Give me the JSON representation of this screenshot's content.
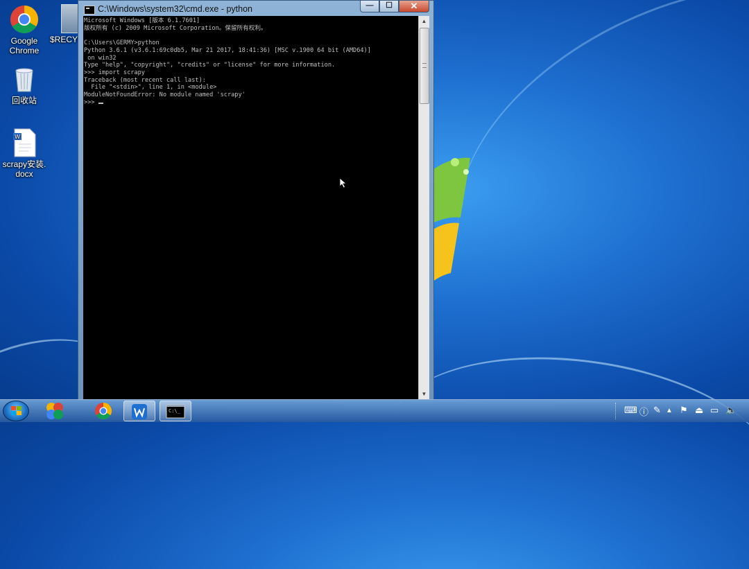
{
  "desktop": {
    "icons": [
      {
        "label": "Google\nChrome"
      },
      {
        "label": "$RECYC"
      },
      {
        "label": "回收站"
      },
      {
        "label": "scrapy安装.\ndocx"
      }
    ]
  },
  "window": {
    "title": "C:\\Windows\\system32\\cmd.exe - python",
    "min_label": "—",
    "max_label": "☐",
    "close_label": "✕"
  },
  "console": {
    "lines": [
      "Microsoft Windows [版本 6.1.7601]",
      "版权所有 (c) 2009 Microsoft Corporation。保留所有权利。",
      "",
      "C:\\Users\\GERMY>python",
      "Python 3.6.1 (v3.6.1:69c0db5, Mar 21 2017, 18:41:36) [MSC v.1900 64 bit (AMD64)]",
      " on win32",
      "Type \"help\", \"copyright\", \"credits\" or \"license\" for more information.",
      ">>> import scrapy",
      "Traceback (most recent call last):",
      "  File \"<stdin>\", line 1, in <module>",
      "ModuleNotFoundError: No module named 'scrapy'",
      ">>> "
    ]
  },
  "taskbar": {
    "items": [
      "start",
      "photo-app",
      "chrome",
      "wps-writer",
      "cmd"
    ]
  },
  "colors": {
    "console_bg": "#000000",
    "console_fg": "#c0c0c0",
    "desktop_blue": "#1e6fd0"
  }
}
